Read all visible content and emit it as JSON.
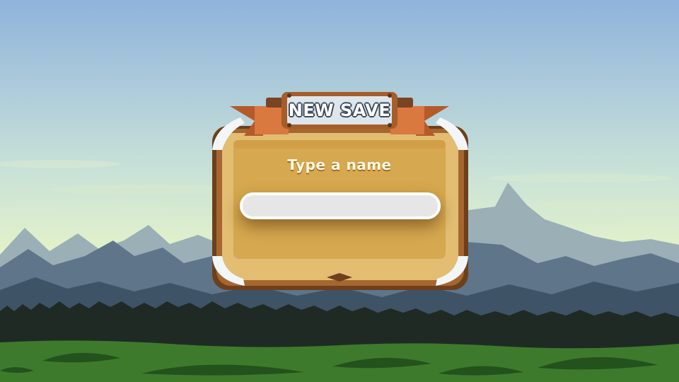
{
  "dialog": {
    "title": "NEW SAVE",
    "prompt": "Type a name",
    "name_input": {
      "value": "",
      "placeholder": ""
    }
  },
  "colors": {
    "sky_top": "#8fb3dc",
    "sky_bottom": "#e8f5c6",
    "panel_fill": "#d9ac55",
    "panel_border": "#7a4a20",
    "ribbon": "#d9783f",
    "grass": "#3d7a2c"
  }
}
